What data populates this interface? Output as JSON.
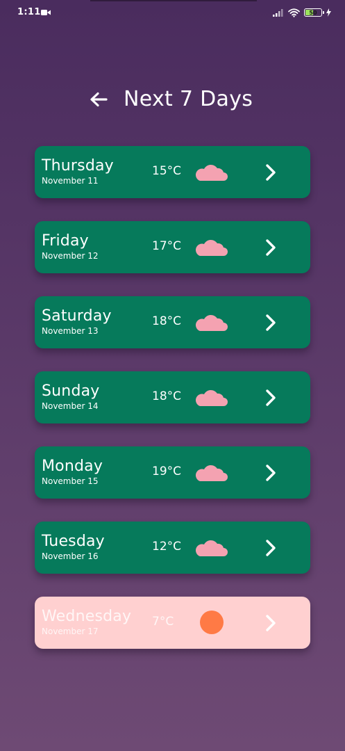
{
  "status_bar": {
    "time": "1:11",
    "battery_level": "50"
  },
  "header": {
    "title": "Next 7 Days",
    "back_icon": "arrow-left-icon"
  },
  "colors": {
    "card": "#067a5b",
    "card_selected": "#ffd0d0",
    "cloud": "#f4a2b1",
    "sun": "#ff7a45",
    "background_top": "#4a2c5e",
    "background_bottom": "#6e4a74"
  },
  "days": [
    {
      "name": "Thursday",
      "date": "November 11",
      "temp": "15°C",
      "icon": "cloud-icon",
      "selected": false
    },
    {
      "name": "Friday",
      "date": "November 12",
      "temp": "17°C",
      "icon": "cloud-icon",
      "selected": false
    },
    {
      "name": "Saturday",
      "date": "November 13",
      "temp": "18°C",
      "icon": "cloud-icon",
      "selected": false
    },
    {
      "name": "Sunday",
      "date": "November 14",
      "temp": "18°C",
      "icon": "cloud-icon",
      "selected": false
    },
    {
      "name": "Monday",
      "date": "November 15",
      "temp": "19°C",
      "icon": "cloud-icon",
      "selected": false
    },
    {
      "name": "Tuesday",
      "date": "November 16",
      "temp": "12°C",
      "icon": "cloud-icon",
      "selected": false
    },
    {
      "name": "Wednesday",
      "date": "November 17",
      "temp": "7°C",
      "icon": "sun-icon",
      "selected": true
    }
  ]
}
